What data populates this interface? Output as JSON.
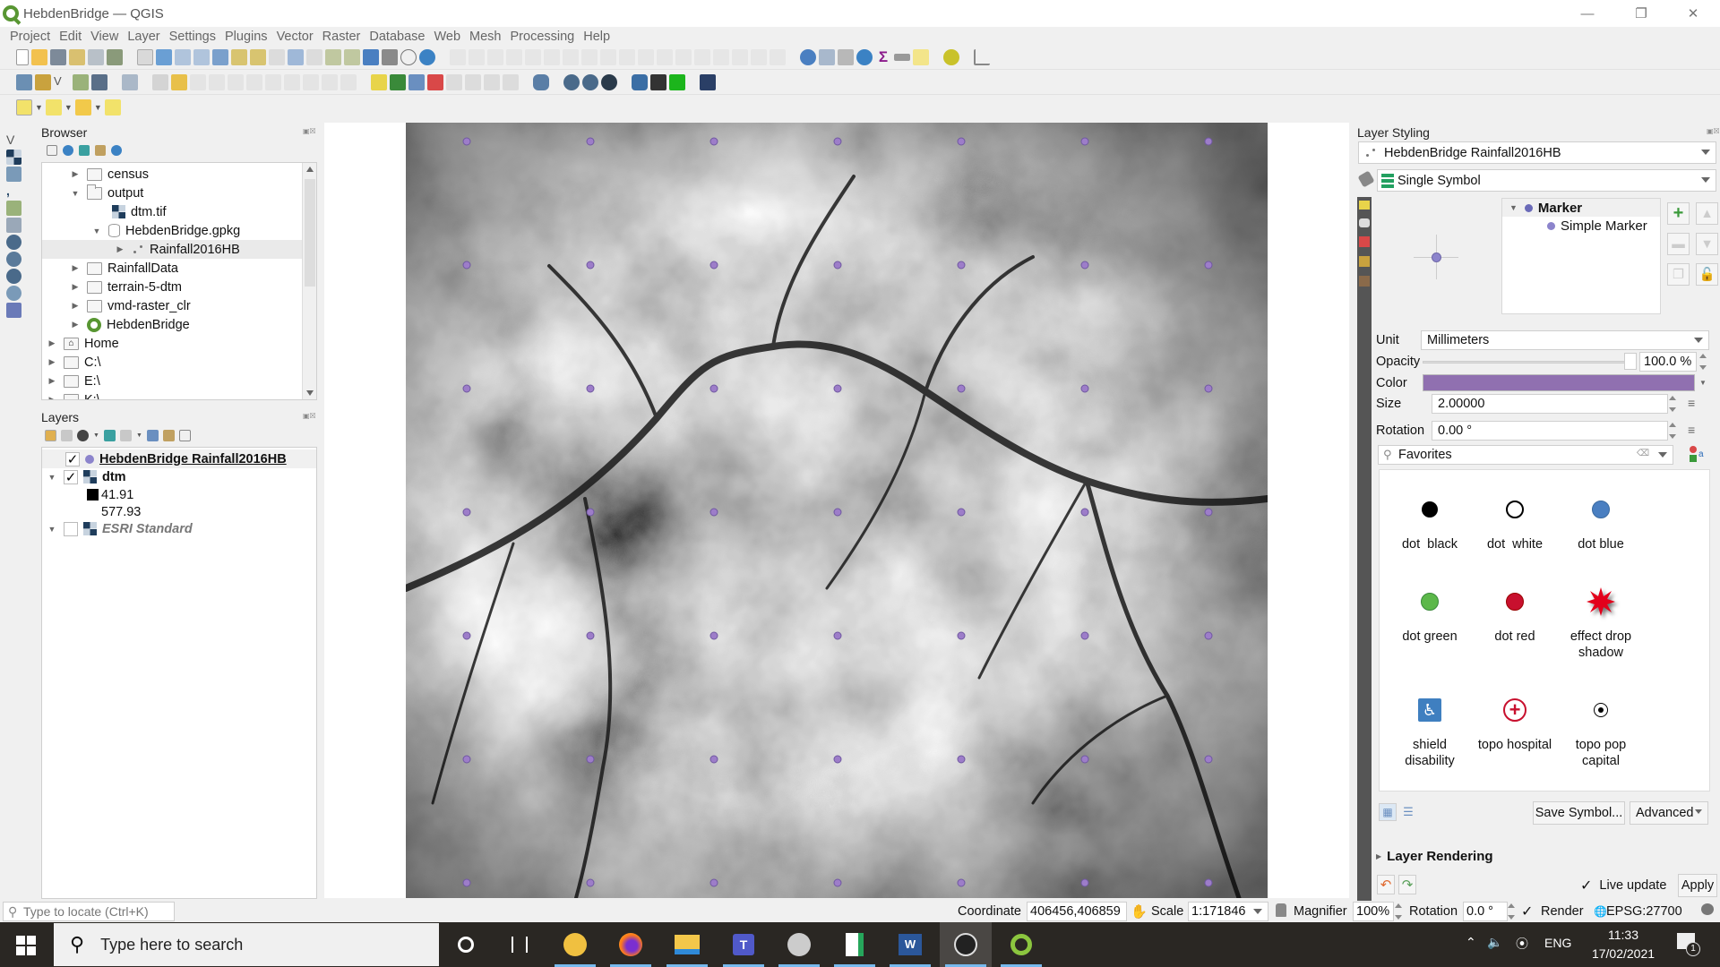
{
  "window": {
    "title": "HebdenBridge — QGIS",
    "controls": [
      "minimize",
      "restore",
      "close"
    ]
  },
  "menu": [
    "Project",
    "Edit",
    "View",
    "Layer",
    "Settings",
    "Plugins",
    "Vector",
    "Raster",
    "Database",
    "Web",
    "Mesh",
    "Processing",
    "Help"
  ],
  "browser": {
    "title": "Browser",
    "items": [
      {
        "label": "census",
        "type": "folder",
        "level": 1,
        "expanded": false
      },
      {
        "label": "output",
        "type": "folder",
        "level": 1,
        "expanded": true
      },
      {
        "label": "dtm.tif",
        "type": "raster",
        "level": 2
      },
      {
        "label": "HebdenBridge.gpkg",
        "type": "geopackage",
        "level": 2,
        "expanded": true
      },
      {
        "label": "Rainfall2016HB",
        "type": "points",
        "level": 3,
        "selected": true
      },
      {
        "label": "RainfallData",
        "type": "folder",
        "level": 1
      },
      {
        "label": "terrain-5-dtm",
        "type": "folder",
        "level": 1
      },
      {
        "label": "vmd-raster_clr",
        "type": "folder",
        "level": 1
      },
      {
        "label": "HebdenBridge",
        "type": "qgis-project",
        "level": 1
      },
      {
        "label": "Home",
        "type": "home",
        "level": 0
      },
      {
        "label": "C:\\",
        "type": "drive",
        "level": 0
      },
      {
        "label": "E:\\",
        "type": "drive",
        "level": 0
      },
      {
        "label": "K:\\",
        "type": "drive",
        "level": 0
      }
    ]
  },
  "layers": {
    "title": "Layers",
    "items": [
      {
        "label": "HebdenBridge Rainfall2016HB",
        "checked": true,
        "bold": true,
        "underline": true,
        "symbol_color": "#8c84cc"
      },
      {
        "label": "dtm",
        "checked": true,
        "bold": true,
        "legend": {
          "min": "41.91",
          "max": "577.93"
        }
      },
      {
        "label": "ESRI Standard",
        "checked": false,
        "italic": true
      }
    ]
  },
  "map": {
    "point_color": "#9d7dc9",
    "point_grid": {
      "columns": 7,
      "rows": 7
    }
  },
  "styling": {
    "title": "Layer Styling",
    "layer": "HebdenBridge Rainfall2016HB",
    "renderer": "Single Symbol",
    "symbol_tree": {
      "root": "Marker",
      "child": "Simple Marker"
    },
    "unit_label": "Unit",
    "unit": "Millimeters",
    "opacity_label": "Opacity",
    "opacity": "100.0 %",
    "opacity_value": 1.0,
    "color_label": "Color",
    "color": "#9070b0",
    "size_label": "Size",
    "size": "2.00000",
    "rotation_label": "Rotation",
    "rotation": "0.00 °",
    "search_placeholder": "Favorites",
    "favorites": [
      {
        "label": "dot  black",
        "symbol": "dot",
        "color": "#000000"
      },
      {
        "label": "dot  white",
        "symbol": "dot-outline",
        "color": "#ffffff"
      },
      {
        "label": "dot blue",
        "symbol": "dot",
        "color": "#4a7fc1"
      },
      {
        "label": "dot green",
        "symbol": "dot",
        "color": "#5cb84a"
      },
      {
        "label": "dot red",
        "symbol": "dot",
        "color": "#c8102e"
      },
      {
        "label": "effect drop shadow",
        "symbol": "star-burst",
        "color": "#e3001b"
      },
      {
        "label": "shield disability",
        "symbol": "disability",
        "color": "#3f7fc0"
      },
      {
        "label": "topo hospital",
        "symbol": "hospital",
        "color": "#c8102e"
      },
      {
        "label": "topo pop capital",
        "symbol": "capital",
        "color": "#000000"
      }
    ],
    "save_symbol": "Save Symbol...",
    "advanced": "Advanced",
    "layer_rendering": "Layer Rendering",
    "live_update": "Live update",
    "live_update_checked": true,
    "apply": "Apply"
  },
  "locator": {
    "placeholder": "Type to locate (Ctrl+K)"
  },
  "status": {
    "coordinate_label": "Coordinate",
    "coordinate": "406456,406859",
    "scale_label": "Scale",
    "scale": "1:171846",
    "magnifier_label": "Magnifier",
    "magnifier": "100%",
    "rotation_label": "Rotation",
    "rotation": "0.0 °",
    "render_label": "Render",
    "render_checked": true,
    "crs": "EPSG:27700"
  },
  "taskbar": {
    "search_placeholder": "Type here to search",
    "apps": [
      "cortana",
      "task-view",
      "app-yellow-disc",
      "firefox",
      "file-explorer",
      "teams",
      "app-grey",
      "libreoffice-calc",
      "word",
      "obs",
      "qgis"
    ],
    "tray": {
      "language": "ENG",
      "time": "11:33",
      "date": "17/02/2021",
      "notifications": "1"
    }
  }
}
